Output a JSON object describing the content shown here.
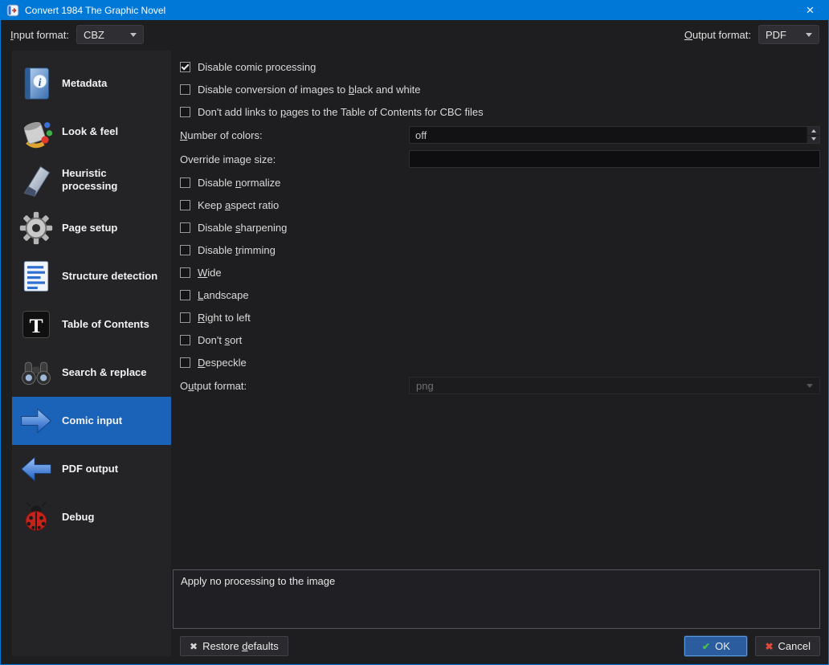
{
  "window": {
    "title": "Convert 1984 The Graphic Novel",
    "close_glyph": "×"
  },
  "format_bar": {
    "input_label": "&Input format:",
    "input_value": "CBZ",
    "output_label": "&Output format:",
    "output_value": "PDF"
  },
  "sidebar": {
    "items": [
      {
        "label": "Metadata",
        "icon": "book-info",
        "selected": false
      },
      {
        "label": "Look & feel",
        "icon": "paint-can",
        "selected": false
      },
      {
        "label": "Heuristic processing",
        "icon": "brush-sweep",
        "selected": false
      },
      {
        "label": "Page setup",
        "icon": "gear",
        "selected": false
      },
      {
        "label": "Structure detection",
        "icon": "document-lines",
        "selected": false
      },
      {
        "label": "Table of Contents",
        "icon": "letter-t-tile",
        "selected": false
      },
      {
        "label": "Search & replace",
        "icon": "binoculars",
        "selected": false
      },
      {
        "label": "Comic input",
        "icon": "arrow-right",
        "selected": true
      },
      {
        "label": "PDF output",
        "icon": "arrow-left",
        "selected": false
      },
      {
        "label": "Debug",
        "icon": "ladybug",
        "selected": false
      }
    ]
  },
  "panel": {
    "cb_comic": {
      "label": "Disable comic processing",
      "checked": true
    },
    "cb_bw": {
      "label": "Disable conversion of images to &black and white",
      "checked": false
    },
    "cb_links": {
      "label": "Don't add links to &pages to the Table of Contents for CBC files",
      "checked": false
    },
    "num_colors": {
      "label": "&Number of colors:",
      "value": "off"
    },
    "img_size": {
      "label": "Override image size:",
      "value": ""
    },
    "cb_normalize": {
      "label": "Disable &normalize",
      "checked": false
    },
    "cb_aspect": {
      "label": "Keep &aspect ratio",
      "checked": false
    },
    "cb_sharpen": {
      "label": "Disable &sharpening",
      "checked": false
    },
    "cb_trim": {
      "label": "Disable &trimming",
      "checked": false
    },
    "cb_wide": {
      "label": "&Wide",
      "checked": false
    },
    "cb_landscape": {
      "label": "&Landscape",
      "checked": false
    },
    "cb_rtl": {
      "label": "&Right to left",
      "checked": false
    },
    "cb_sort": {
      "label": "Don't &sort",
      "checked": false
    },
    "cb_despeckle": {
      "label": "&Despeckle",
      "checked": false
    },
    "out_fmt": {
      "label": "O&utput format:",
      "value": "png",
      "disabled": true
    },
    "help_text": "Apply no processing to the image"
  },
  "footer": {
    "restore_label": "Restore &defaults",
    "ok_label": "OK",
    "cancel_label": "Cancel",
    "ok_icon": "✔",
    "cancel_icon": "✖",
    "restore_icon": "✖"
  },
  "colors": {
    "titlebar": "#0078d7",
    "selection": "#1a63b8",
    "window_bg": "#1e1e20"
  }
}
